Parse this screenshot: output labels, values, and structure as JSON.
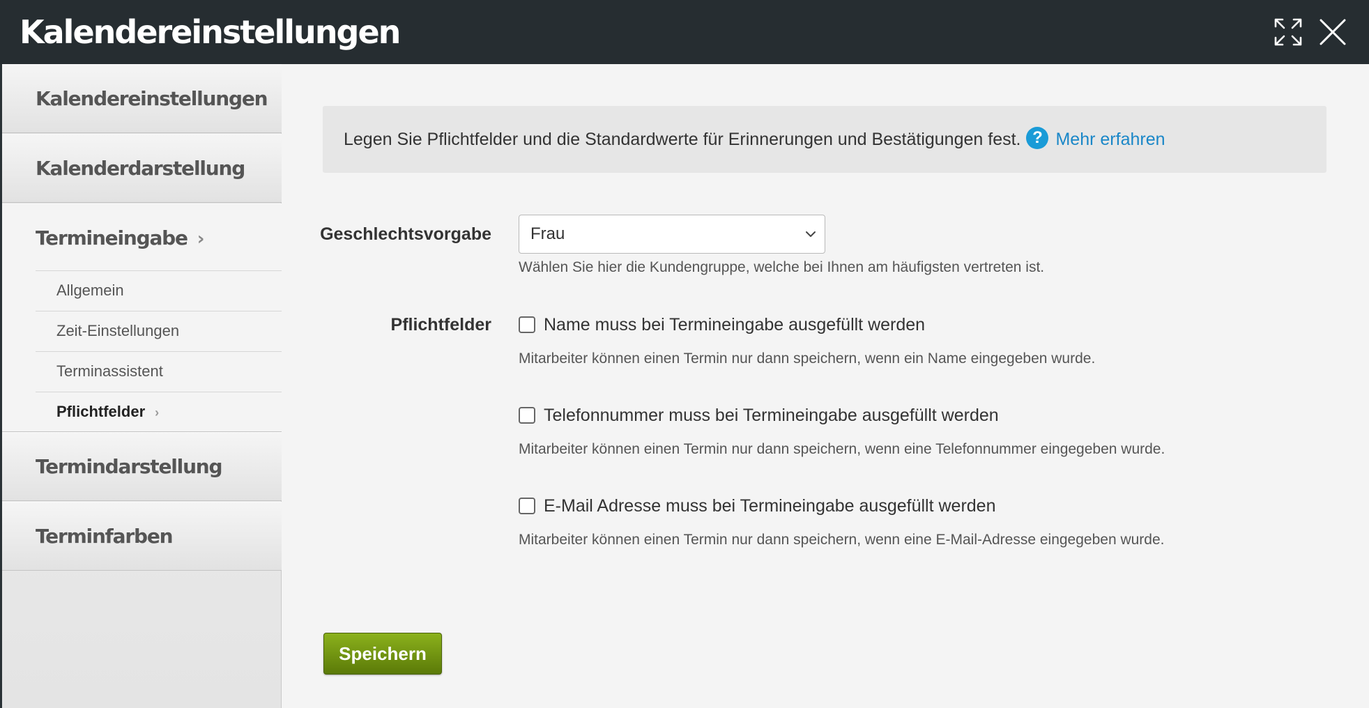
{
  "header": {
    "title": "Kalendereinstellungen",
    "icons": [
      "expand-icon",
      "close-icon"
    ]
  },
  "sidebar": {
    "items": [
      {
        "label": "Kalendereinstellungen"
      },
      {
        "label": "Kalenderdarstellung"
      },
      {
        "label": "Termineingabe",
        "chevron": "›"
      },
      {
        "label": "Termindarstellung"
      },
      {
        "label": "Terminfarben"
      }
    ],
    "subitems": [
      {
        "label": "Allgemein"
      },
      {
        "label": "Zeit-Einstellungen"
      },
      {
        "label": "Terminassistent"
      },
      {
        "label": "Pflichtfelder",
        "chevron": "›"
      }
    ]
  },
  "main": {
    "info_text": "Legen Sie Pflichtfelder und die Standardwerte für Erinnerungen und Bestätigungen fest.",
    "info_link": "Mehr erfahren",
    "gender_label": "Geschlechtsvorgabe",
    "gender_value": "Frau",
    "gender_hint": "Wählen Sie hier die Kundengruppe, welche bei Ihnen am häufigsten vertreten ist.",
    "required_label": "Pflichtfelder",
    "checkboxes": [
      {
        "label": "Name muss bei Termineingabe ausgefüllt werden",
        "hint": "Mitarbeiter können einen Termin nur dann speichern, wenn ein Name eingegeben wurde.",
        "checked": false
      },
      {
        "label": "Telefonnummer muss bei Termineingabe ausgefüllt werden",
        "hint": "Mitarbeiter können einen Termin nur dann speichern, wenn eine Telefonnummer eingegeben wurde.",
        "checked": false
      },
      {
        "label": "E-Mail Adresse muss bei Termineingabe ausgefüllt werden",
        "hint": "Mitarbeiter können einen Termin nur dann speichern, wenn eine E-Mail-Adresse eingegeben wurde.",
        "checked": false
      }
    ],
    "save_label": "Speichern"
  },
  "colors": {
    "header_bg": "#262d31",
    "link": "#1a87c8",
    "help_icon": "#1a9bd7",
    "save_button": "#6f9412"
  }
}
